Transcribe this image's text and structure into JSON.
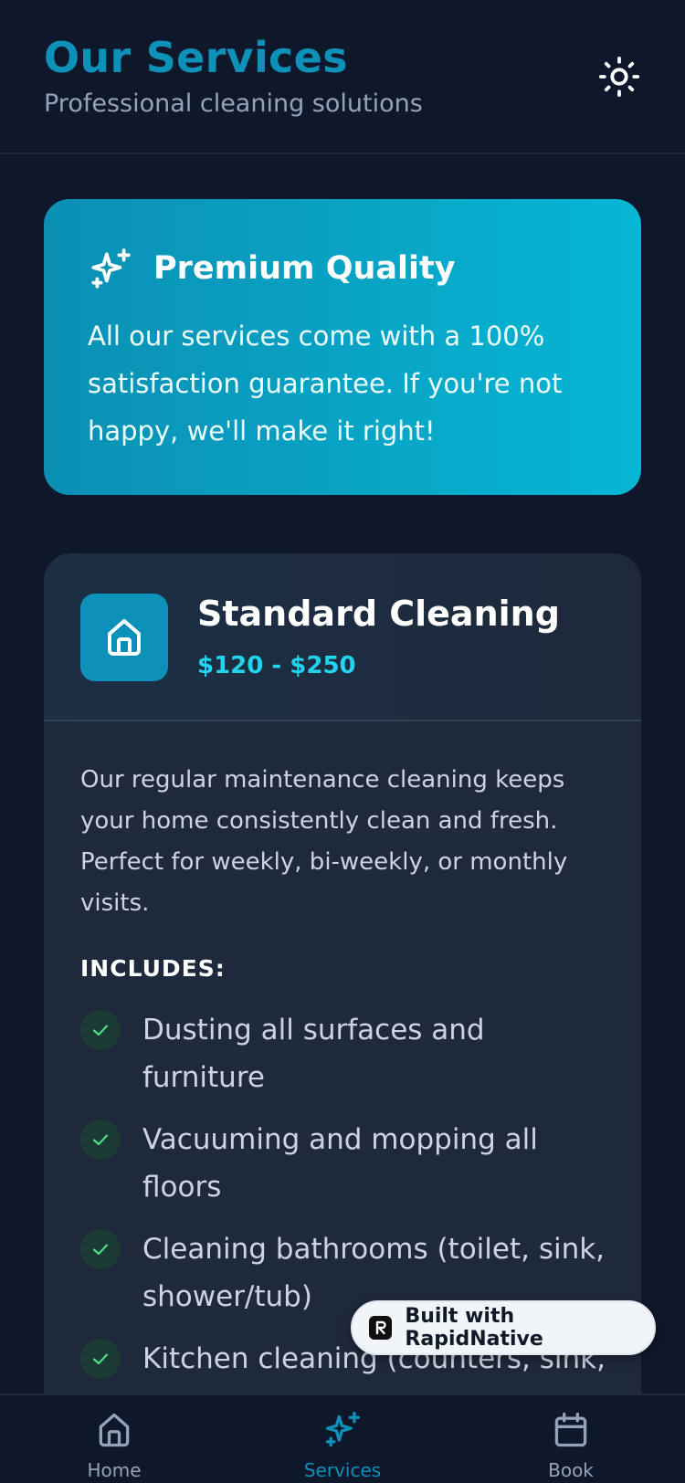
{
  "header": {
    "title": "Our Services",
    "subtitle": "Professional cleaning solutions",
    "theme_icon": "sun-icon"
  },
  "banner": {
    "icon": "sparkles-icon",
    "title": "Premium Quality",
    "text": "All our services come with a 100% satisfaction guarantee. If you're not happy, we'll make it right!"
  },
  "service": {
    "icon": "home-icon",
    "title": "Standard Cleaning",
    "price": "$120 - $250",
    "description": "Our regular maintenance cleaning keeps your home consistently clean and fresh. Perfect for weekly, bi-weekly, or monthly visits.",
    "includes_label": "INCLUDES:",
    "includes": [
      "Dusting all surfaces and furniture",
      "Vacuuming and mopping all floors",
      "Cleaning bathrooms (toilet, sink, shower/tub)",
      "Kitchen cleaning (counters, sink, appliances)"
    ]
  },
  "badge": {
    "text": "Built with RapidNative"
  },
  "tabs": [
    {
      "label": "Home",
      "icon": "home-icon",
      "active": false
    },
    {
      "label": "Services",
      "icon": "sparkles-icon",
      "active": true
    },
    {
      "label": "Book",
      "icon": "calendar-icon",
      "active": false
    }
  ],
  "colors": {
    "background": "#0f172a",
    "accent": "#0e91b8",
    "price": "#22d3ee",
    "card": "#1e293b",
    "check": "#4ade80"
  }
}
